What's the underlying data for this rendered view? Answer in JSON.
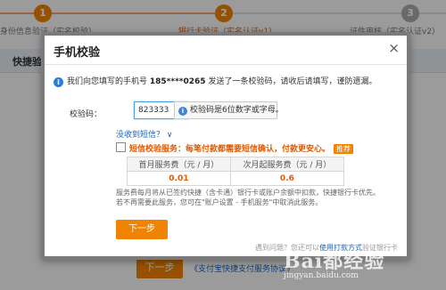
{
  "steps": [
    {
      "num": "1",
      "label": "身份信息验证（实名校验）"
    },
    {
      "num": "2",
      "label": "银行卡验证（实名认证v1）"
    },
    {
      "num": "3",
      "label": "证件审核（实名认证v2）"
    }
  ],
  "background": {
    "section_title": "快捷验",
    "next_label": "下一步",
    "agreement_link": "《支付宝快捷支付服务协议》"
  },
  "modal": {
    "title": "手机校验",
    "close": "×",
    "info_prefix": "我们向您填写的手机号",
    "phone": "185****0265",
    "info_suffix": "发送了一条校验码，请收后请填写，谨防遗漏。",
    "code_label": "校验码：",
    "code_value": "823333",
    "hint": "校验码是6位数字或字母。",
    "resend_link": "没收到短信？ ∨",
    "sms_service": "短信校验服务：每笔付款都需要短信确认，付款更安心。",
    "recommend_badge": "推荐",
    "fee_table": {
      "headers": [
        "首月服务费（元 / 月）",
        "次月起服务费（元 / 月）"
      ],
      "values": [
        "0.01",
        "0.6"
      ]
    },
    "note": "服务费每月将从已签约快捷（含卡通）银行卡或账户余额中扣款，快捷银行卡优先。若不再需要此服务，您可在\"账户设置 - 手机服务\"中取消此服务。",
    "next_button": "下一步",
    "help_prefix": "遇到问题？您还可以",
    "help_link": "使用打款方式",
    "help_suffix": "验证银行卡"
  },
  "watermark": {
    "text": "Bai都经验",
    "sub": "jingyan.baidu.com"
  },
  "colors": {
    "accent": "#f08300",
    "link": "#1a62b7",
    "warning_text": "#e05a00"
  }
}
